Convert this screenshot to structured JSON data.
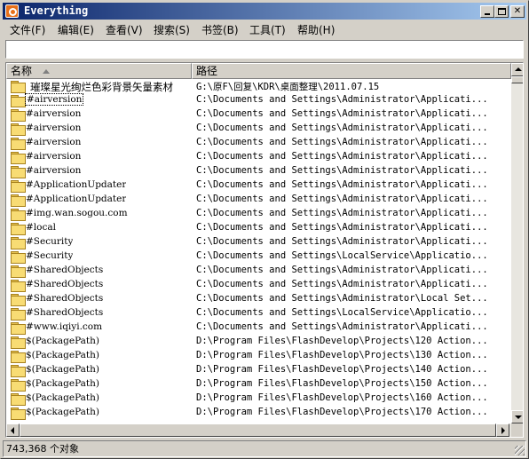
{
  "window": {
    "title": "Everything"
  },
  "menu": [
    {
      "label": "文件(F)",
      "key": "file"
    },
    {
      "label": "编辑(E)",
      "key": "edit"
    },
    {
      "label": "查看(V)",
      "key": "view"
    },
    {
      "label": "搜索(S)",
      "key": "search"
    },
    {
      "label": "书签(B)",
      "key": "bookmarks"
    },
    {
      "label": "工具(T)",
      "key": "tools"
    },
    {
      "label": "帮助(H)",
      "key": "help"
    }
  ],
  "search": {
    "value": ""
  },
  "columns": {
    "name": "名称",
    "path": "路径"
  },
  "rows": [
    {
      "name": "璀璨星光绚烂色彩背景矢量素材",
      "path": "G:\\原F\\回复\\KDR\\桌面整理\\2011.07.15"
    },
    {
      "name": "#airversion",
      "path": "C:\\Documents and Settings\\Administrator\\Applicati..."
    },
    {
      "name": "#airversion",
      "path": "C:\\Documents and Settings\\Administrator\\Applicati..."
    },
    {
      "name": "#airversion",
      "path": "C:\\Documents and Settings\\Administrator\\Applicati..."
    },
    {
      "name": "#airversion",
      "path": "C:\\Documents and Settings\\Administrator\\Applicati..."
    },
    {
      "name": "#airversion",
      "path": "C:\\Documents and Settings\\Administrator\\Applicati..."
    },
    {
      "name": "#airversion",
      "path": "C:\\Documents and Settings\\Administrator\\Applicati..."
    },
    {
      "name": "#ApplicationUpdater",
      "path": "C:\\Documents and Settings\\Administrator\\Applicati..."
    },
    {
      "name": "#ApplicationUpdater",
      "path": "C:\\Documents and Settings\\Administrator\\Applicati..."
    },
    {
      "name": "#img.wan.sogou.com",
      "path": "C:\\Documents and Settings\\Administrator\\Applicati..."
    },
    {
      "name": "#local",
      "path": "C:\\Documents and Settings\\Administrator\\Applicati..."
    },
    {
      "name": "#Security",
      "path": "C:\\Documents and Settings\\Administrator\\Applicati..."
    },
    {
      "name": "#Security",
      "path": "C:\\Documents and Settings\\LocalService\\Applicatio..."
    },
    {
      "name": "#SharedObjects",
      "path": "C:\\Documents and Settings\\Administrator\\Applicati..."
    },
    {
      "name": "#SharedObjects",
      "path": "C:\\Documents and Settings\\Administrator\\Applicati..."
    },
    {
      "name": "#SharedObjects",
      "path": "C:\\Documents and Settings\\Administrator\\Local Set..."
    },
    {
      "name": "#SharedObjects",
      "path": "C:\\Documents and Settings\\LocalService\\Applicatio..."
    },
    {
      "name": "#www.iqiyi.com",
      "path": "C:\\Documents and Settings\\Administrator\\Applicati..."
    },
    {
      "name": "$(PackagePath)",
      "path": "D:\\Program Files\\FlashDevelop\\Projects\\120 Action..."
    },
    {
      "name": "$(PackagePath)",
      "path": "D:\\Program Files\\FlashDevelop\\Projects\\130 Action..."
    },
    {
      "name": "$(PackagePath)",
      "path": "D:\\Program Files\\FlashDevelop\\Projects\\140 Action..."
    },
    {
      "name": "$(PackagePath)",
      "path": "D:\\Program Files\\FlashDevelop\\Projects\\150 Action..."
    },
    {
      "name": "$(PackagePath)",
      "path": "D:\\Program Files\\FlashDevelop\\Projects\\160 Action..."
    },
    {
      "name": "$(PackagePath)",
      "path": "D:\\Program Files\\FlashDevelop\\Projects\\170 Action..."
    }
  ],
  "status": {
    "text": "743,368 个对象"
  },
  "icons": {
    "app": "everything-app-icon",
    "row": "folder-icon",
    "sort": "sort-ascending-icon"
  },
  "colors": {
    "titlebar_start": "#0a246a",
    "titlebar_end": "#a6caf0",
    "folder": "#f8dc74"
  }
}
